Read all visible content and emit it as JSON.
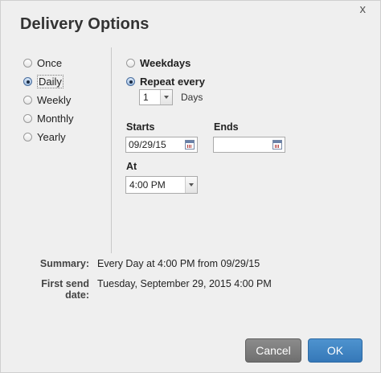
{
  "dialog": {
    "title": "Delivery Options",
    "close_glyph": "x"
  },
  "frequency": {
    "options": [
      {
        "label": "Once",
        "checked": false
      },
      {
        "label": "Daily",
        "checked": true
      },
      {
        "label": "Weekly",
        "checked": false
      },
      {
        "label": "Monthly",
        "checked": false
      },
      {
        "label": "Yearly",
        "checked": false
      }
    ]
  },
  "daily": {
    "weekdays_label": "Weekdays",
    "weekdays_checked": false,
    "repeat_label": "Repeat every",
    "repeat_checked": true,
    "interval_value": "1",
    "interval_unit": "Days"
  },
  "schedule": {
    "starts_label": "Starts",
    "starts_value": "09/29/15",
    "ends_label": "Ends",
    "ends_value": "",
    "at_label": "At",
    "at_value": "4:00 PM"
  },
  "summary": {
    "summary_label": "Summary:",
    "summary_value": "Every Day at 4:00 PM from 09/29/15",
    "first_send_label": "First send date:",
    "first_send_value": "Tuesday, September 29, 2015 4:00 PM"
  },
  "buttons": {
    "cancel": "Cancel",
    "ok": "OK"
  },
  "colors": {
    "ok_button": "#3a7fbf",
    "cancel_button": "#7a7a7a",
    "background": "#efefef"
  },
  "icons": {
    "calendar": "calendar-icon",
    "dropdown": "chevron-down-icon",
    "close": "close-icon"
  }
}
